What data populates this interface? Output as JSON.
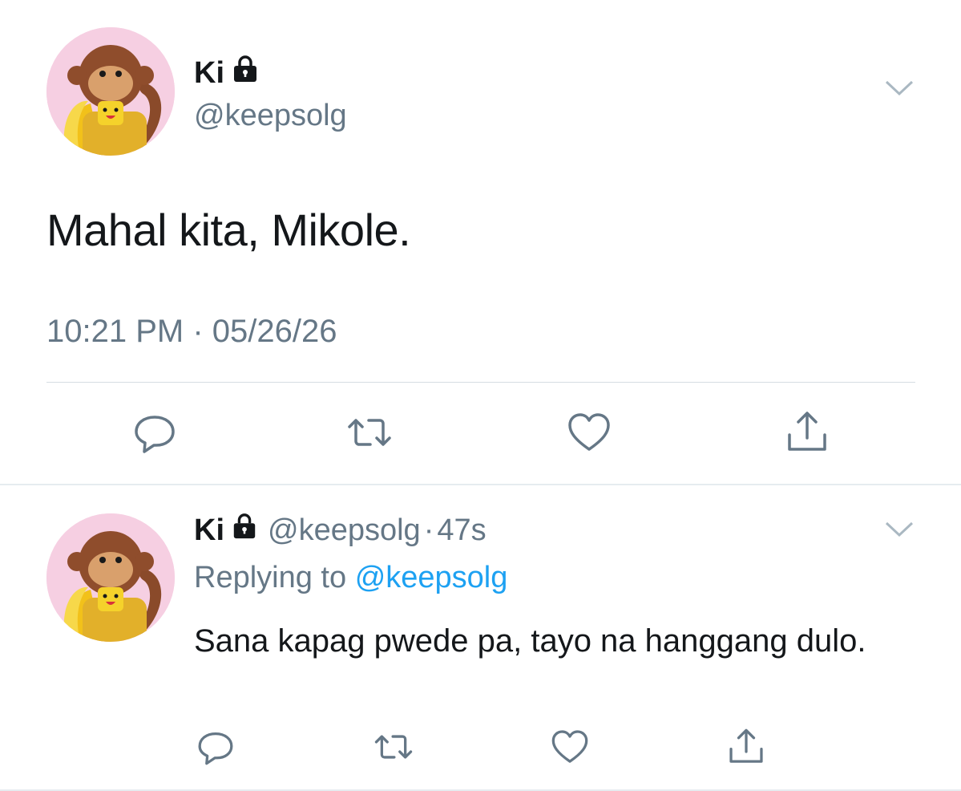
{
  "main_tweet": {
    "author_name": "Ki",
    "handle": "@keepsolg",
    "text": "Mahal kita, Mikole.",
    "timestamp": "10:21 PM · 05/26/26",
    "protected_icon": "lock-icon",
    "menu_icon": "chevron-down-icon",
    "actions": [
      "reply-icon",
      "retweet-icon",
      "like-icon",
      "share-icon"
    ]
  },
  "reply_tweet": {
    "author_name": "Ki",
    "handle": "@keepsolg",
    "separator": "·",
    "age": "47s",
    "replying_prefix": "Replying to",
    "replying_user": "@keepsolg",
    "text": "Sana kapag pwede pa, tayo na hanggang dulo.",
    "protected_icon": "lock-icon",
    "menu_icon": "chevron-down-icon",
    "actions": [
      "reply-icon",
      "retweet-icon",
      "like-icon",
      "share-icon"
    ]
  },
  "colors": {
    "text": "#14171a",
    "secondary": "#657786",
    "link": "#1da1f2",
    "divider": "#e6ecf0"
  }
}
